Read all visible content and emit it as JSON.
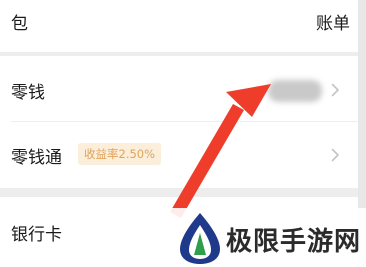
{
  "header": {
    "title": "包",
    "bill_link": "账单"
  },
  "rows": [
    {
      "label": "零钱",
      "value_hidden": true
    },
    {
      "label": "零钱通",
      "badge": "收益率2.50%"
    },
    {
      "label": "银行卡"
    }
  ],
  "icons": {
    "chevron": "chevron-right-icon",
    "annotation": "red-arrow-icon"
  },
  "colors": {
    "background": "#ededed",
    "card": "#ffffff",
    "badge_bg": "#fbeedb",
    "badge_text": "#e0a35b",
    "arrow": "#ef3d2c"
  },
  "watermark": {
    "text": "极限手游网"
  }
}
